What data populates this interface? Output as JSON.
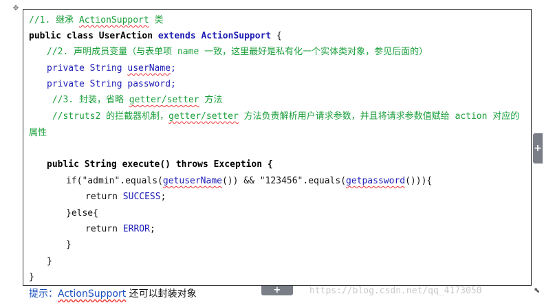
{
  "code": {
    "l1": "//1. 继承 ",
    "l1_cls": "ActionSupport",
    "l1_tail": " 类",
    "l2_public": "public class ",
    "l2_name": "UserAction",
    "l2_extends": " extends ",
    "l2_super": "ActionSupport",
    "l2_brace": " {",
    "l3": "//2. 声明成员变量（与表单项 name 一致，这里最好是私有化一个实体类对象，参见后面的）",
    "l4_kw": "private String ",
    "l4_var": "userName",
    "l4_end": ";",
    "l5_kw": "private String ",
    "l5_var": "password",
    "l5_end": ";",
    "l6_a": " //3. 封装，省略 ",
    "l6_b": "getter/setter",
    "l6_c": " 方法",
    "l7_a": " //struts2 的拦截器机制，",
    "l7_b": "getter/setter",
    "l7_c": " 方法负责解析用户请求参数，并且将请求参数值赋给 action 对应的",
    "l8": "属性",
    "l9_kw1": "public String execute() ",
    "l9_kw2": "throws",
    "l9_kw3": " Exception {",
    "l10_a": "if(\"admin\".equals(",
    "l10_b": "getuserName",
    "l10_c": "()) && \"123456\".equals(",
    "l10_d": "getpassword",
    "l10_e": "())){",
    "l11_a": "return ",
    "l11_b": "SUCCESS",
    "l11_c": ";",
    "l12": "}else{",
    "l13_a": "return ",
    "l13_b": "ERROR",
    "l13_c": ";",
    "l14": "}",
    "l15": "}",
    "l16": "}"
  },
  "hint": {
    "label": "提示：",
    "link": "ActionSupport",
    "tail": " 还可以封装对象"
  },
  "watermark": "https://blog.csdn.net/qq_4173050",
  "buttons": {
    "side_add": "+",
    "bottom_add": "+"
  },
  "icons": {
    "move": "✥",
    "resize": "⬉"
  }
}
